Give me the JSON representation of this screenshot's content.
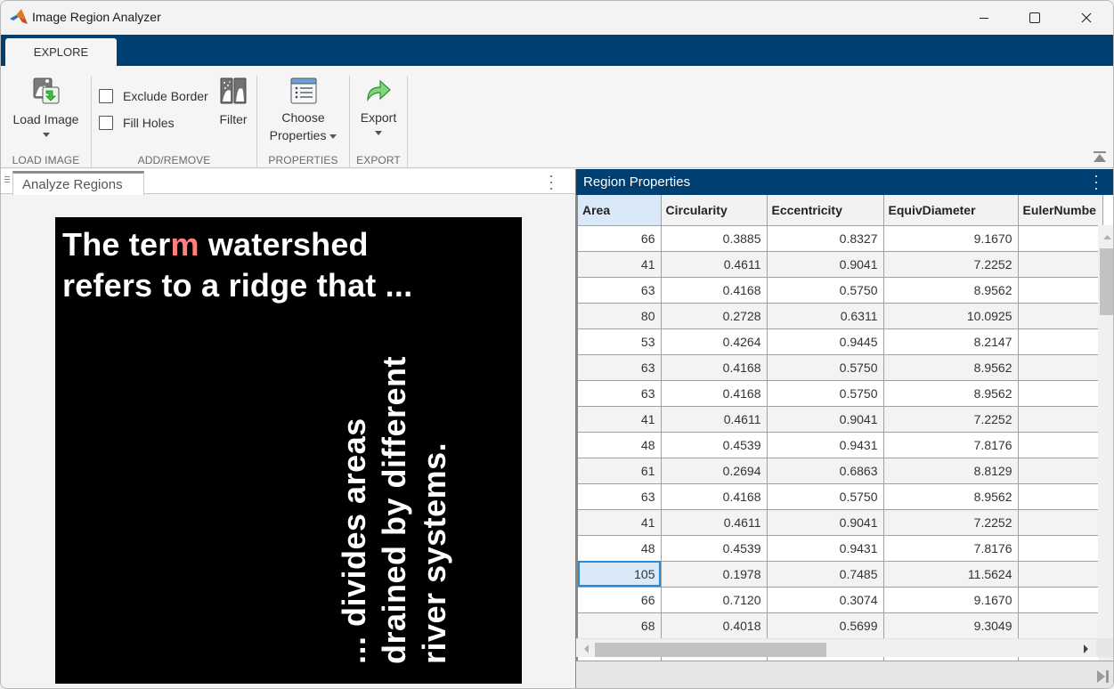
{
  "window": {
    "title": "Image Region Analyzer",
    "controls": {
      "minimize": "minimize",
      "maximize": "maximize",
      "close": "close"
    }
  },
  "ribbon": {
    "tabs": [
      {
        "label": "EXPLORE",
        "active": true
      }
    ],
    "groups": {
      "load_image": {
        "label": "LOAD IMAGE",
        "button": "Load Image"
      },
      "add_remove": {
        "label": "ADD/REMOVE",
        "exclude_border": {
          "label": "Exclude Border",
          "checked": false
        },
        "fill_holes": {
          "label": "Fill Holes",
          "checked": false
        },
        "filter": "Filter"
      },
      "properties": {
        "label": "PROPERTIES",
        "button_line1": "Choose",
        "button_line2": "Properties"
      },
      "export": {
        "label": "EXPORT",
        "button": "Export"
      }
    }
  },
  "left_panel": {
    "tab_label": "Analyze Regions",
    "image_text": {
      "line1_pre": "The ter",
      "line1_highlight": "m",
      "line1_post": " watershed",
      "line2": "refers to a ridge that ...",
      "vertical_line1": "... divides areas",
      "vertical_line2": "drained by different",
      "vertical_line3": "river systems."
    },
    "highlight_color": "#ff8080"
  },
  "right_panel": {
    "title": "Region Properties",
    "columns": [
      "Area",
      "Circularity",
      "Eccentricity",
      "EquivDiameter",
      "EulerNumbe"
    ],
    "selected_column": "Area",
    "selected_row_index": 13,
    "rows": [
      [
        "66",
        "0.3885",
        "0.8327",
        "9.1670",
        ""
      ],
      [
        "41",
        "0.4611",
        "0.9041",
        "7.2252",
        ""
      ],
      [
        "63",
        "0.4168",
        "0.5750",
        "8.9562",
        ""
      ],
      [
        "80",
        "0.2728",
        "0.6311",
        "10.0925",
        ""
      ],
      [
        "53",
        "0.4264",
        "0.9445",
        "8.2147",
        ""
      ],
      [
        "63",
        "0.4168",
        "0.5750",
        "8.9562",
        ""
      ],
      [
        "63",
        "0.4168",
        "0.5750",
        "8.9562",
        ""
      ],
      [
        "41",
        "0.4611",
        "0.9041",
        "7.2252",
        ""
      ],
      [
        "48",
        "0.4539",
        "0.9431",
        "7.8176",
        ""
      ],
      [
        "61",
        "0.2694",
        "0.6863",
        "8.8129",
        ""
      ],
      [
        "63",
        "0.4168",
        "0.5750",
        "8.9562",
        ""
      ],
      [
        "41",
        "0.4611",
        "0.9041",
        "7.2252",
        ""
      ],
      [
        "48",
        "0.4539",
        "0.9431",
        "7.8176",
        ""
      ],
      [
        "105",
        "0.1978",
        "0.7485",
        "11.5624",
        ""
      ],
      [
        "66",
        "0.7120",
        "0.3074",
        "9.1670",
        ""
      ],
      [
        "68",
        "0.4018",
        "0.5699",
        "9.3049",
        ""
      ],
      [
        "",
        "",
        "",
        "",
        ""
      ]
    ]
  },
  "colors": {
    "brand_blue": "#003f72",
    "selection_fill": "#d9e9f7",
    "selection_border": "#2a8ad4"
  }
}
